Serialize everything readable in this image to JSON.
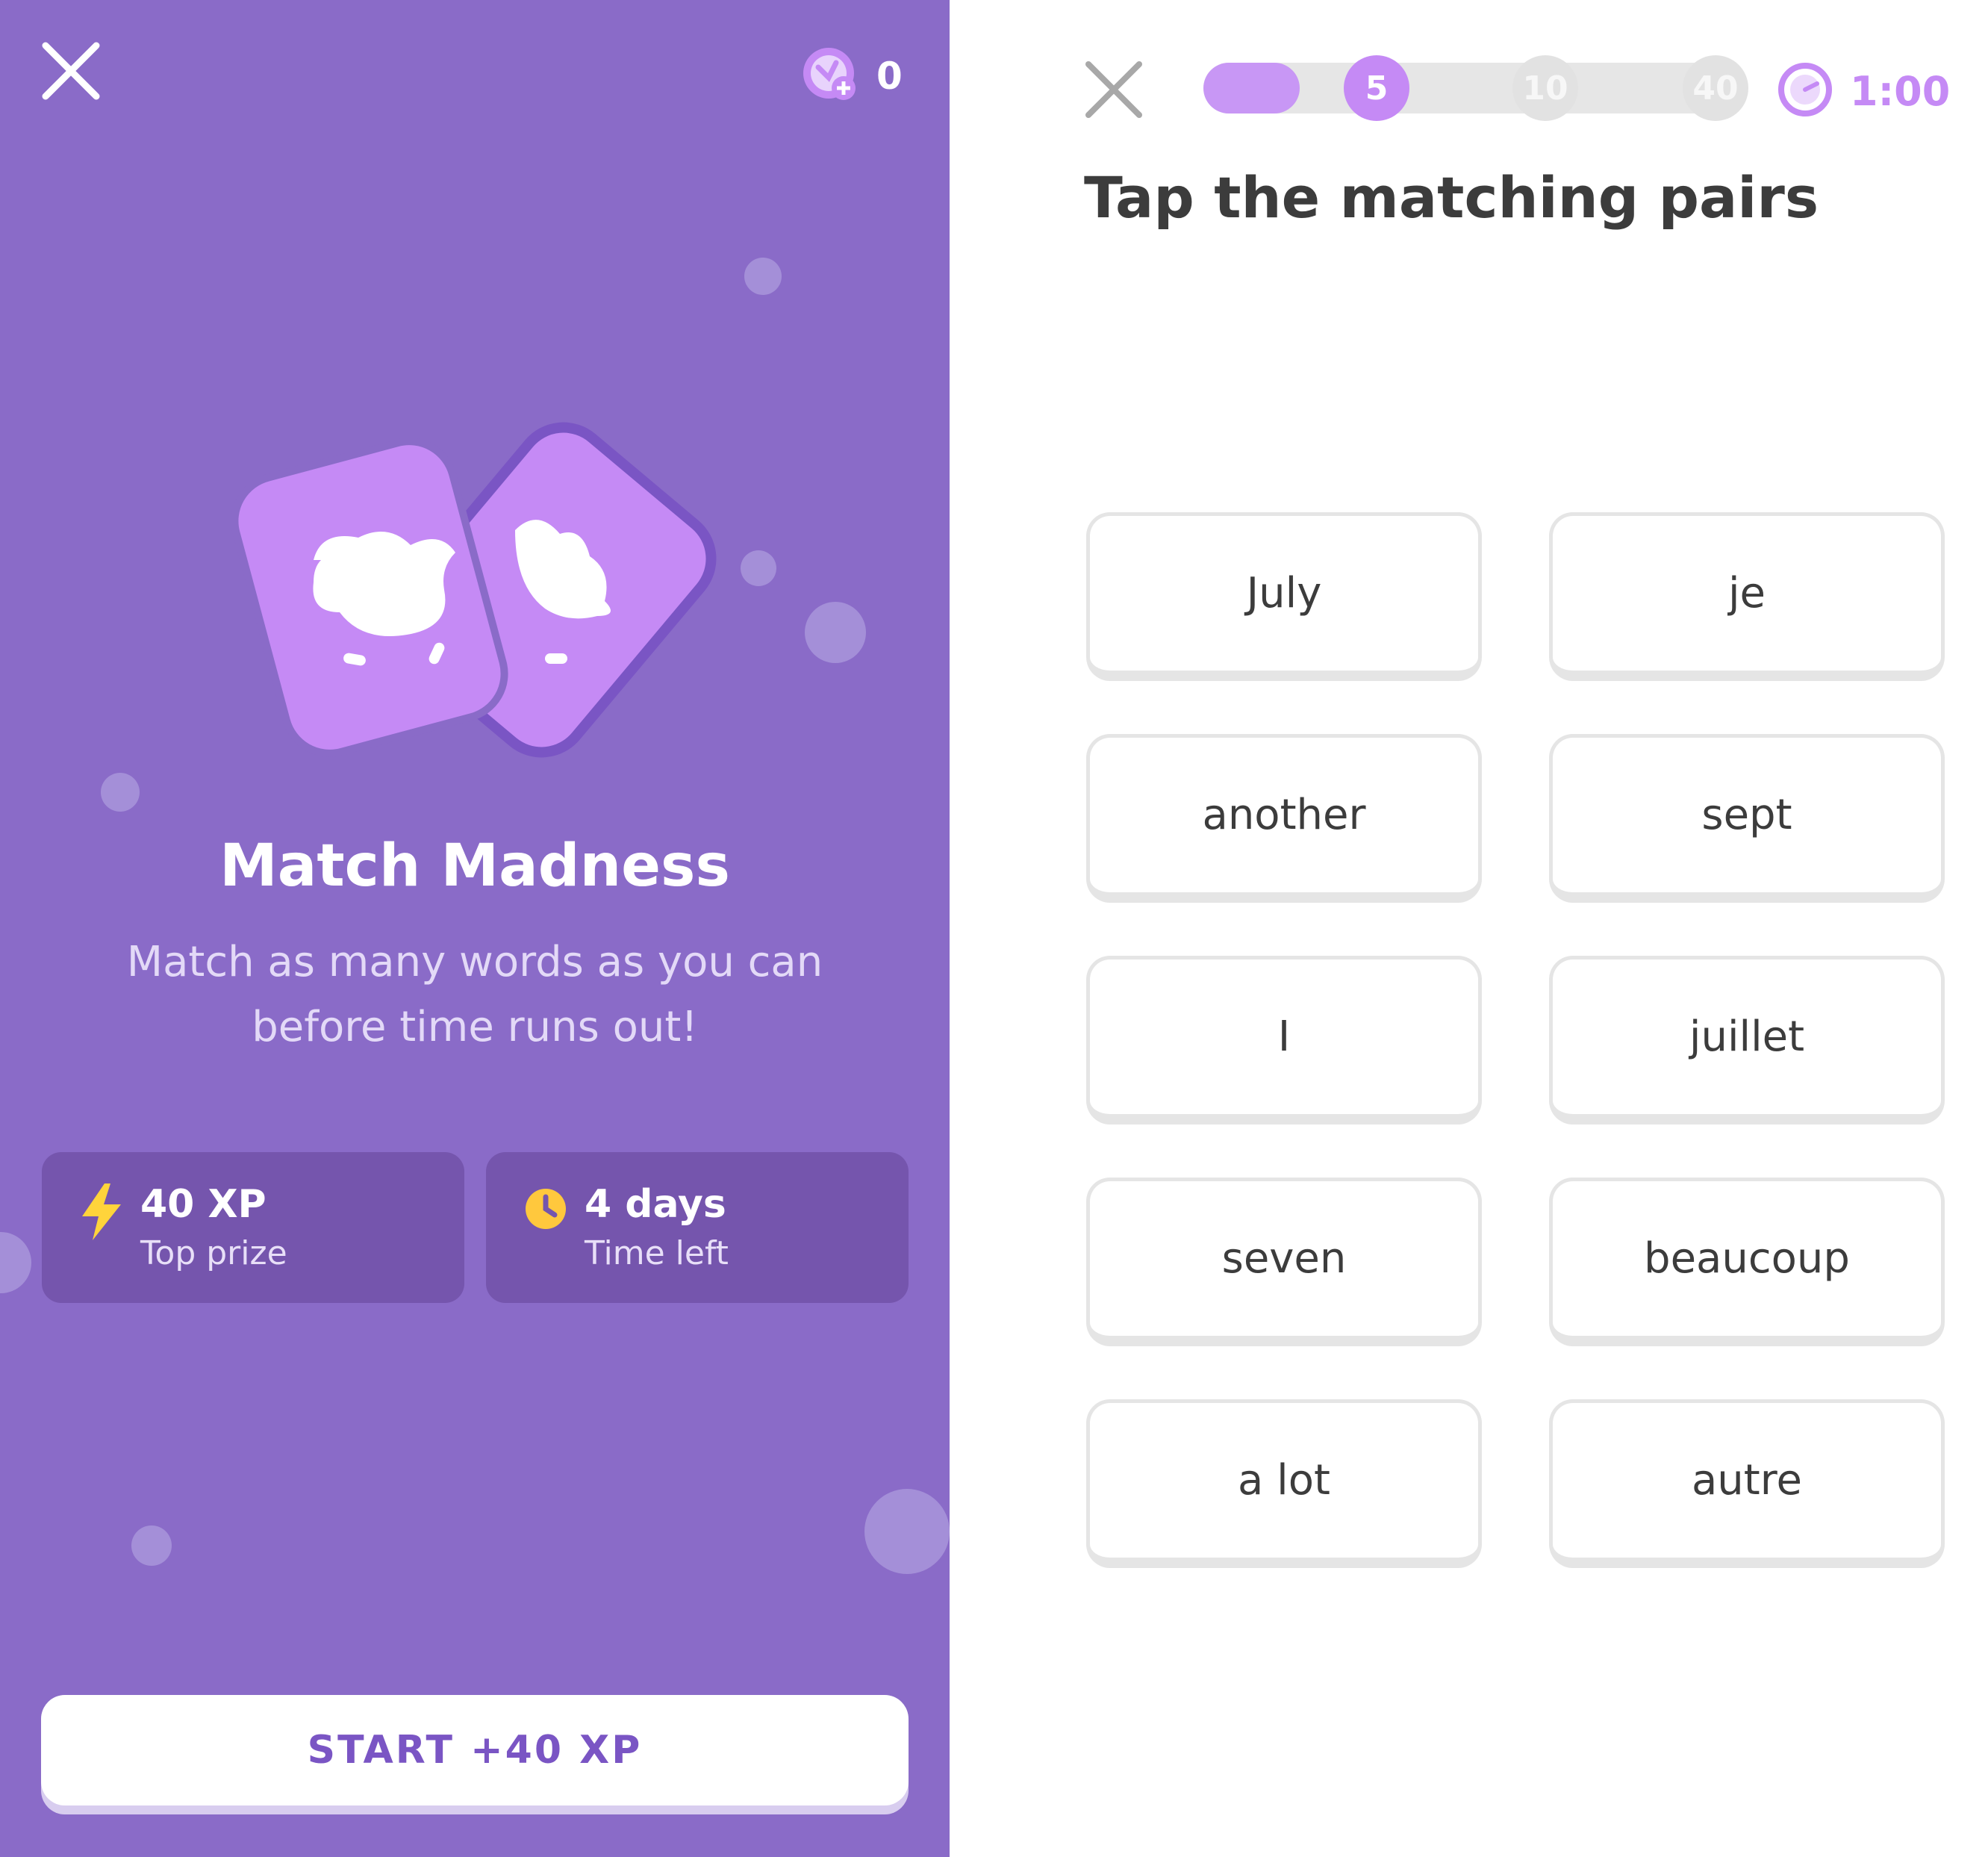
{
  "left_panel": {
    "gems": {
      "icon": "gem-plus-icon",
      "count": "0"
    },
    "illustration": "matching-cards-icon",
    "title": "Match Madness",
    "subtitle": "Match as many words as you can before time runs out!",
    "stats": [
      {
        "icon": "lightning-icon",
        "value": "40 XP",
        "label": "Top prize",
        "color": "#ffd43b"
      },
      {
        "icon": "clock-icon",
        "value": "4 days",
        "label": "Time left",
        "color": "#ffc83d"
      }
    ],
    "start_button": "START +40 XP",
    "colors": {
      "background": "#8a6bc8",
      "card": "#c58af5",
      "stat_card": "#7555ad"
    }
  },
  "right_panel": {
    "progress": {
      "fill_fraction": 0.18,
      "milestones": [
        {
          "label": "5",
          "active": true
        },
        {
          "label": "10",
          "active": false
        },
        {
          "label": "40",
          "active": false
        }
      ]
    },
    "timer": {
      "icon": "timer-icon",
      "value": "1:00"
    },
    "prompt": "Tap the matching pairs",
    "tiles_left": [
      "July",
      "another",
      "I",
      "seven",
      "a lot"
    ],
    "tiles_right": [
      "je",
      "sept",
      "juillet",
      "beaucoup",
      "autre"
    ],
    "colors": {
      "accent": "#c58af5",
      "text": "#3c3c3c",
      "tile_border": "#e5e5e5"
    }
  }
}
